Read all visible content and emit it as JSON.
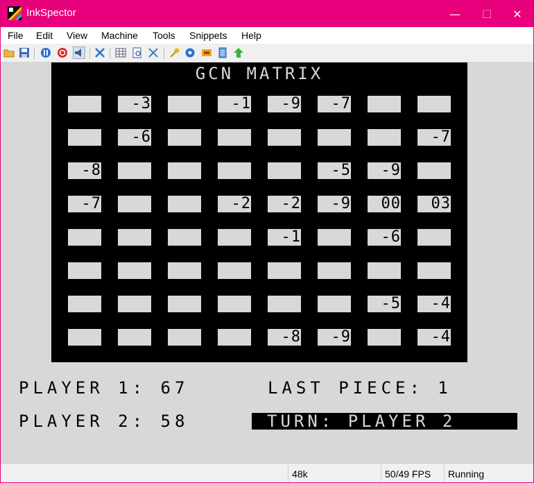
{
  "window": {
    "title": "InkSpector",
    "minimize_icon": "minimize-icon",
    "maximize_icon": "maximize-icon",
    "close_icon": "close-icon",
    "minimize_glyph": "—",
    "maximize_glyph": "☐",
    "close_glyph": "✕"
  },
  "menu": [
    "File",
    "Edit",
    "View",
    "Machine",
    "Tools",
    "Snippets",
    "Help"
  ],
  "toolbar": {
    "icons": [
      "open-folder-icon",
      "save-icon",
      "pause-icon",
      "stop-icon",
      "sound-icon",
      "fullscreen-icon",
      "memory-viewer-icon",
      "disassembler-icon",
      "debug-tools-icon",
      "key-icon",
      "settings-gear-icon",
      "tape-icon",
      "script-icon",
      "upload-arrow-icon"
    ],
    "selected": "sound-icon"
  },
  "game": {
    "title": "GCN MATRIX",
    "grid": [
      [
        "",
        "-3",
        "",
        "-1",
        "-9",
        "-7",
        "",
        ""
      ],
      [
        "",
        "-6",
        "",
        "",
        "",
        "",
        "",
        "-7"
      ],
      [
        "-8",
        "",
        "",
        "",
        "",
        "-5",
        "-9",
        ""
      ],
      [
        "-7",
        "",
        "",
        "-2",
        "-2",
        "-9",
        "00",
        "03"
      ],
      [
        "",
        "",
        "",
        "",
        "-1",
        "",
        "-6",
        ""
      ],
      [
        "",
        "",
        "",
        "",
        "",
        "",
        "",
        ""
      ],
      [
        "",
        "",
        "",
        "",
        "",
        "",
        "-5",
        "-4"
      ],
      [
        "",
        "",
        "",
        "",
        "-8",
        "-9",
        "",
        "-4"
      ]
    ],
    "player1": "PLAYER 1: 67",
    "player2": "PLAYER 2: 58",
    "last_piece": "LAST PIECE: 1",
    "turn": "TURN: PLAYER 2"
  },
  "status": {
    "memory": "48k",
    "fps": "50/49 FPS",
    "state": "Running"
  },
  "colors": {
    "titlebar": "#e8007c",
    "screen_paper": "#d8d8d8",
    "screen_ink": "#000000"
  }
}
